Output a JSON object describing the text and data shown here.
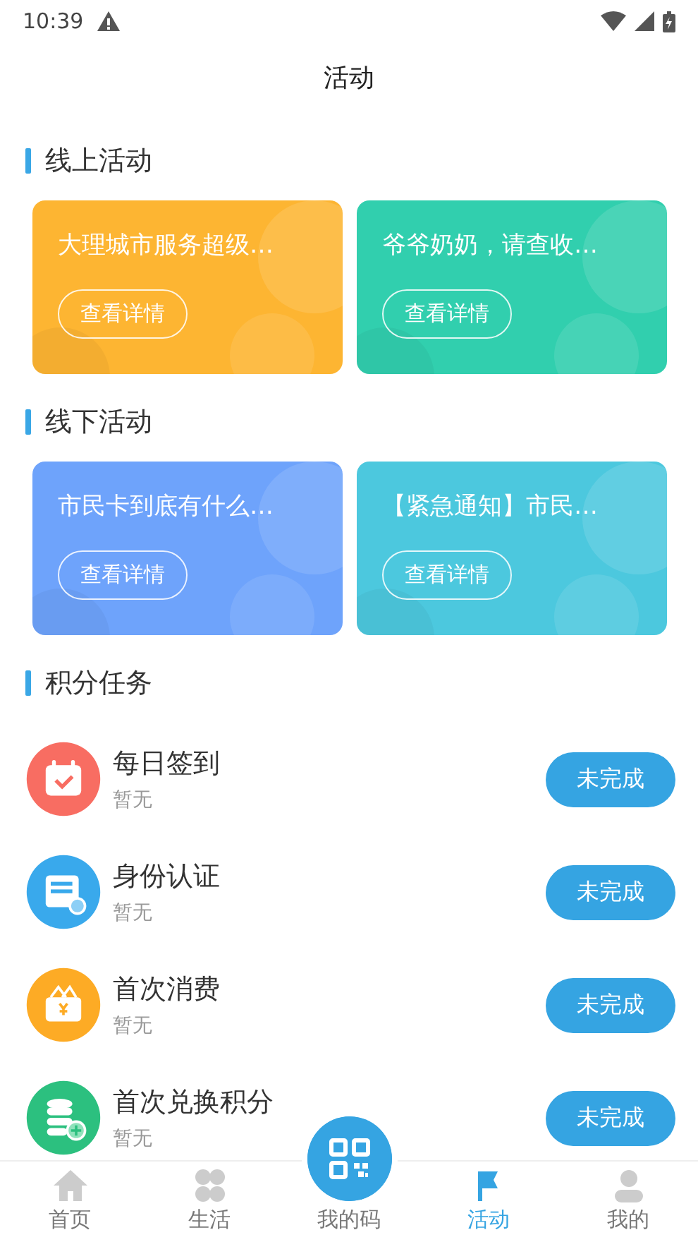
{
  "status_bar": {
    "time": "10:39"
  },
  "title": "活动",
  "sections": [
    {
      "title": "线上活动",
      "cards": [
        {
          "title": "大理城市服务超级…",
          "button": "查看详情",
          "color": "#fdb532"
        },
        {
          "title": "爷爷奶奶，请查收…",
          "button": "查看详情",
          "color": "#31cfae"
        }
      ]
    },
    {
      "title": "线下活动",
      "cards": [
        {
          "title": "市民卡到底有什么…",
          "button": "查看详情",
          "color": "#6ea3fb"
        },
        {
          "title": "【紧急通知】市民…",
          "button": "查看详情",
          "color": "#4cc8de"
        }
      ]
    }
  ],
  "tasks": {
    "title": "积分任务",
    "items": [
      {
        "kind": "calendar",
        "color": "#f86d62",
        "name": "每日签到",
        "note": "暂无",
        "button": "未完成"
      },
      {
        "kind": "card",
        "color": "#39a9ec",
        "name": "身份认证",
        "note": "暂无",
        "button": "未完成"
      },
      {
        "kind": "wallet",
        "color": "#fdab25",
        "name": "首次消费",
        "note": "暂无",
        "button": "未完成"
      },
      {
        "kind": "coins",
        "color": "#2cc07f",
        "name": "首次兑换积分",
        "note": "暂无",
        "button": "未完成"
      }
    ]
  },
  "nav": [
    {
      "kind": "home",
      "label": "首页",
      "selected": false
    },
    {
      "kind": "life",
      "label": "生活",
      "selected": false
    },
    {
      "kind": "qr",
      "label": "我的码",
      "selected": false
    },
    {
      "kind": "activity",
      "label": "活动",
      "selected": true
    },
    {
      "kind": "mine",
      "label": "我的",
      "selected": false
    }
  ]
}
